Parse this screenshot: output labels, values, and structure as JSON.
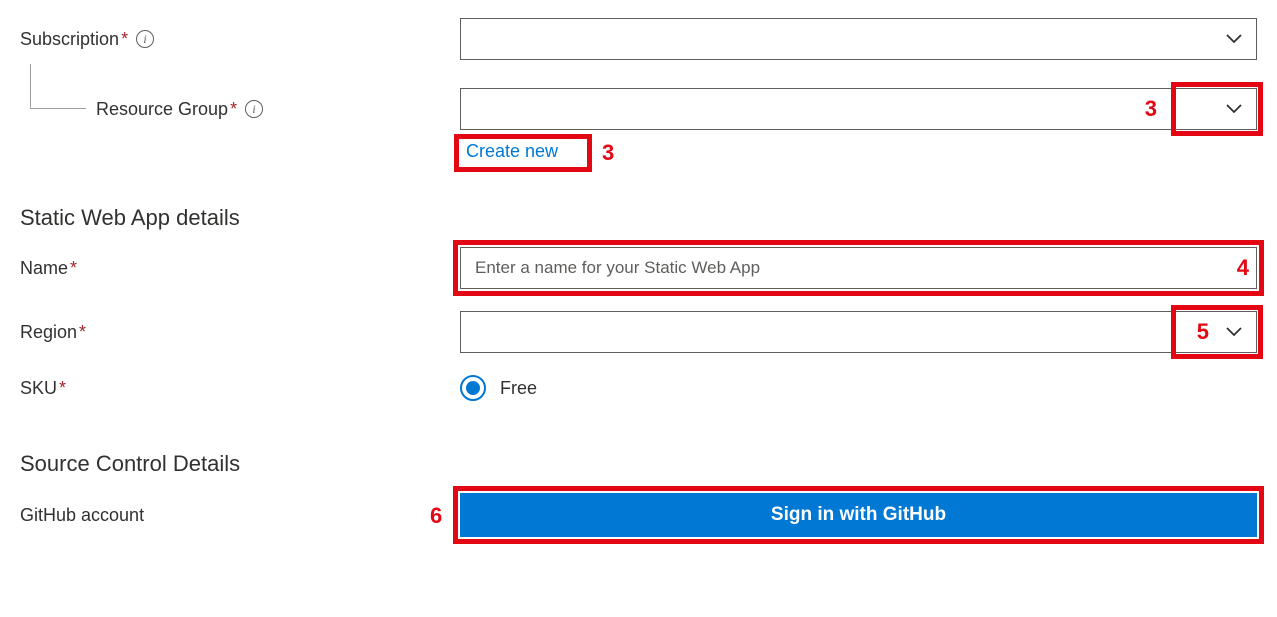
{
  "labels": {
    "subscription": "Subscription",
    "resource_group": "Resource Group",
    "name": "Name",
    "region": "Region",
    "sku": "SKU",
    "github_account": "GitHub account"
  },
  "links": {
    "create_new": "Create new"
  },
  "sections": {
    "static_web_app": "Static Web App details",
    "source_control": "Source Control Details"
  },
  "placeholders": {
    "name": "Enter a name for your Static Web App"
  },
  "sku": {
    "option_free": "Free"
  },
  "buttons": {
    "github_signin": "Sign in with GitHub"
  },
  "callouts": {
    "c3a": "3",
    "c3b": "3",
    "c4": "4",
    "c5": "5",
    "c6": "6"
  }
}
